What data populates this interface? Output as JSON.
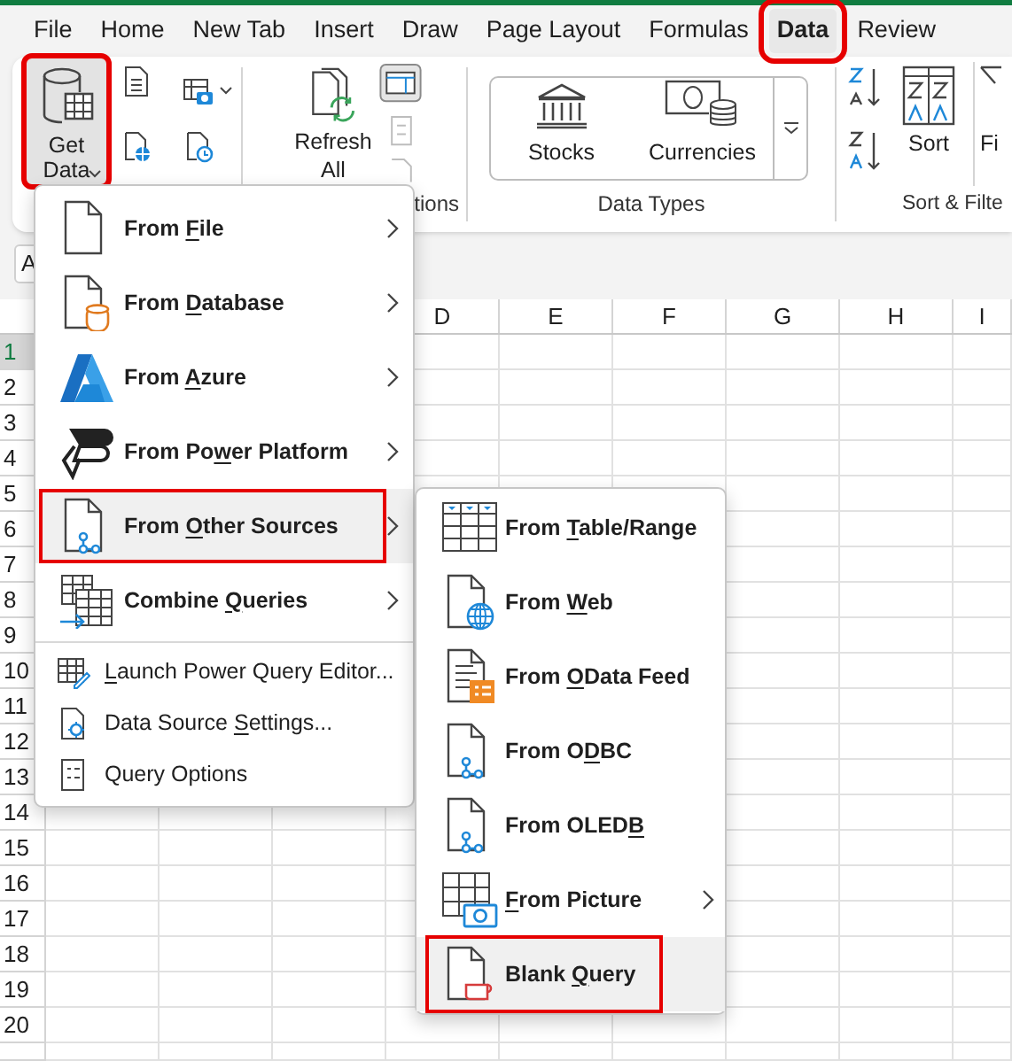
{
  "tabs": [
    {
      "label": "File",
      "selected": false
    },
    {
      "label": "Home",
      "selected": false
    },
    {
      "label": "New Tab",
      "selected": false
    },
    {
      "label": "Insert",
      "selected": false
    },
    {
      "label": "Draw",
      "selected": false
    },
    {
      "label": "Page Layout",
      "selected": false
    },
    {
      "label": "Formulas",
      "selected": false
    },
    {
      "label": "Data",
      "selected": true,
      "annotated": true
    },
    {
      "label": "Review",
      "selected": false
    }
  ],
  "ribbon": {
    "get_data": {
      "label": "Get Data",
      "pressed": true,
      "annotated": true
    },
    "refresh_all": {
      "label": "Refresh All"
    },
    "queries_group_label": "tions",
    "data_types": {
      "items": [
        {
          "label": "Stocks"
        },
        {
          "label": "Currencies"
        }
      ],
      "group_label": "Data Types"
    },
    "sort": {
      "label": "Sort"
    },
    "filter": {
      "label": "Fi"
    },
    "sort_group_label": "Sort & Filte"
  },
  "name_box": {
    "value": "A"
  },
  "grid": {
    "columns": [
      "D",
      "E",
      "F",
      "G",
      "H",
      "I"
    ],
    "rows": [
      {
        "label": "1",
        "selected": true
      },
      {
        "label": "2",
        "selected": false
      },
      {
        "label": "3",
        "selected": false
      },
      {
        "label": "4",
        "selected": false
      },
      {
        "label": "5",
        "selected": false
      },
      {
        "label": "6",
        "selected": false
      },
      {
        "label": "7",
        "selected": false
      },
      {
        "label": "8",
        "selected": false
      },
      {
        "label": "9",
        "selected": false
      },
      {
        "label": "10",
        "selected": false
      },
      {
        "label": "11",
        "selected": false
      },
      {
        "label": "12",
        "selected": false
      },
      {
        "label": "13",
        "selected": false
      },
      {
        "label": "14",
        "selected": false
      },
      {
        "label": "15",
        "selected": false
      },
      {
        "label": "16",
        "selected": false
      },
      {
        "label": "17",
        "selected": false
      },
      {
        "label": "18",
        "selected": false
      },
      {
        "label": "19",
        "selected": false
      },
      {
        "label": "20",
        "selected": false
      }
    ]
  },
  "get_data_menu": {
    "items": [
      {
        "kind": "large",
        "label": [
          {
            "text": "From ",
            "underlined": false
          },
          {
            "text": "F",
            "underlined": true
          },
          {
            "text": "ile",
            "underlined": false
          }
        ],
        "submenu": true,
        "selected": false
      },
      {
        "kind": "large",
        "label": [
          {
            "text": "From ",
            "underlined": false
          },
          {
            "text": "D",
            "underlined": true
          },
          {
            "text": "atabase",
            "underlined": false
          }
        ],
        "submenu": true,
        "selected": false
      },
      {
        "kind": "large",
        "label": [
          {
            "text": "From ",
            "underlined": false
          },
          {
            "text": "A",
            "underlined": true
          },
          {
            "text": "zure",
            "underlined": false
          }
        ],
        "submenu": true,
        "selected": false
      },
      {
        "kind": "large",
        "label": [
          {
            "text": "From Po",
            "underlined": false
          },
          {
            "text": "w",
            "underlined": true
          },
          {
            "text": "er Platform",
            "underlined": false
          }
        ],
        "submenu": true,
        "selected": false
      },
      {
        "kind": "large",
        "label": [
          {
            "text": "From ",
            "underlined": false
          },
          {
            "text": "O",
            "underlined": true
          },
          {
            "text": "ther Sources",
            "underlined": false
          }
        ],
        "submenu": true,
        "selected": true,
        "annotated": true
      },
      {
        "kind": "large",
        "label": [
          {
            "text": "Combine ",
            "underlined": false
          },
          {
            "text": "Q",
            "underlined": true
          },
          {
            "text": "ueries",
            "underlined": false
          }
        ],
        "submenu": true,
        "selected": false
      },
      {
        "kind": "small",
        "label": [
          {
            "text": "L",
            "underlined": true
          },
          {
            "text": "aunch Power Query Editor...",
            "underlined": false
          }
        ],
        "submenu": false,
        "selected": false
      },
      {
        "kind": "small",
        "label": [
          {
            "text": "Data Source ",
            "underlined": false
          },
          {
            "text": "S",
            "underlined": true
          },
          {
            "text": "ettings...",
            "underlined": false
          }
        ],
        "submenu": false,
        "selected": false
      },
      {
        "kind": "small",
        "label": [
          {
            "text": "Query Options",
            "underlined": false
          }
        ],
        "submenu": false,
        "selected": false
      }
    ]
  },
  "other_sources_menu": {
    "items": [
      {
        "label": [
          {
            "text": "From ",
            "underlined": false
          },
          {
            "text": "T",
            "underlined": true
          },
          {
            "text": "able/Range",
            "underlined": false
          }
        ],
        "submenu": false,
        "selected": false
      },
      {
        "label": [
          {
            "text": "From ",
            "underlined": false
          },
          {
            "text": "W",
            "underlined": true
          },
          {
            "text": "eb",
            "underlined": false
          }
        ],
        "submenu": false,
        "selected": false
      },
      {
        "label": [
          {
            "text": "From ",
            "underlined": false
          },
          {
            "text": "O",
            "underlined": true
          },
          {
            "text": "Data Feed",
            "underlined": false
          }
        ],
        "submenu": false,
        "selected": false
      },
      {
        "label": [
          {
            "text": "From O",
            "underlined": false
          },
          {
            "text": "D",
            "underlined": true
          },
          {
            "text": "BC",
            "underlined": false
          }
        ],
        "submenu": false,
        "selected": false
      },
      {
        "label": [
          {
            "text": "From OLED",
            "underlined": false
          },
          {
            "text": "B",
            "underlined": true
          }
        ],
        "submenu": false,
        "selected": false
      },
      {
        "label": [
          {
            "text": "F",
            "underlined": true
          },
          {
            "text": "rom Picture",
            "underlined": false
          }
        ],
        "submenu": true,
        "selected": false
      },
      {
        "label": [
          {
            "text": "Blank ",
            "underlined": false
          },
          {
            "text": "Q",
            "underlined": true
          },
          {
            "text": "uery",
            "underlined": false
          }
        ],
        "submenu": false,
        "selected": true,
        "annotated": true
      }
    ]
  }
}
